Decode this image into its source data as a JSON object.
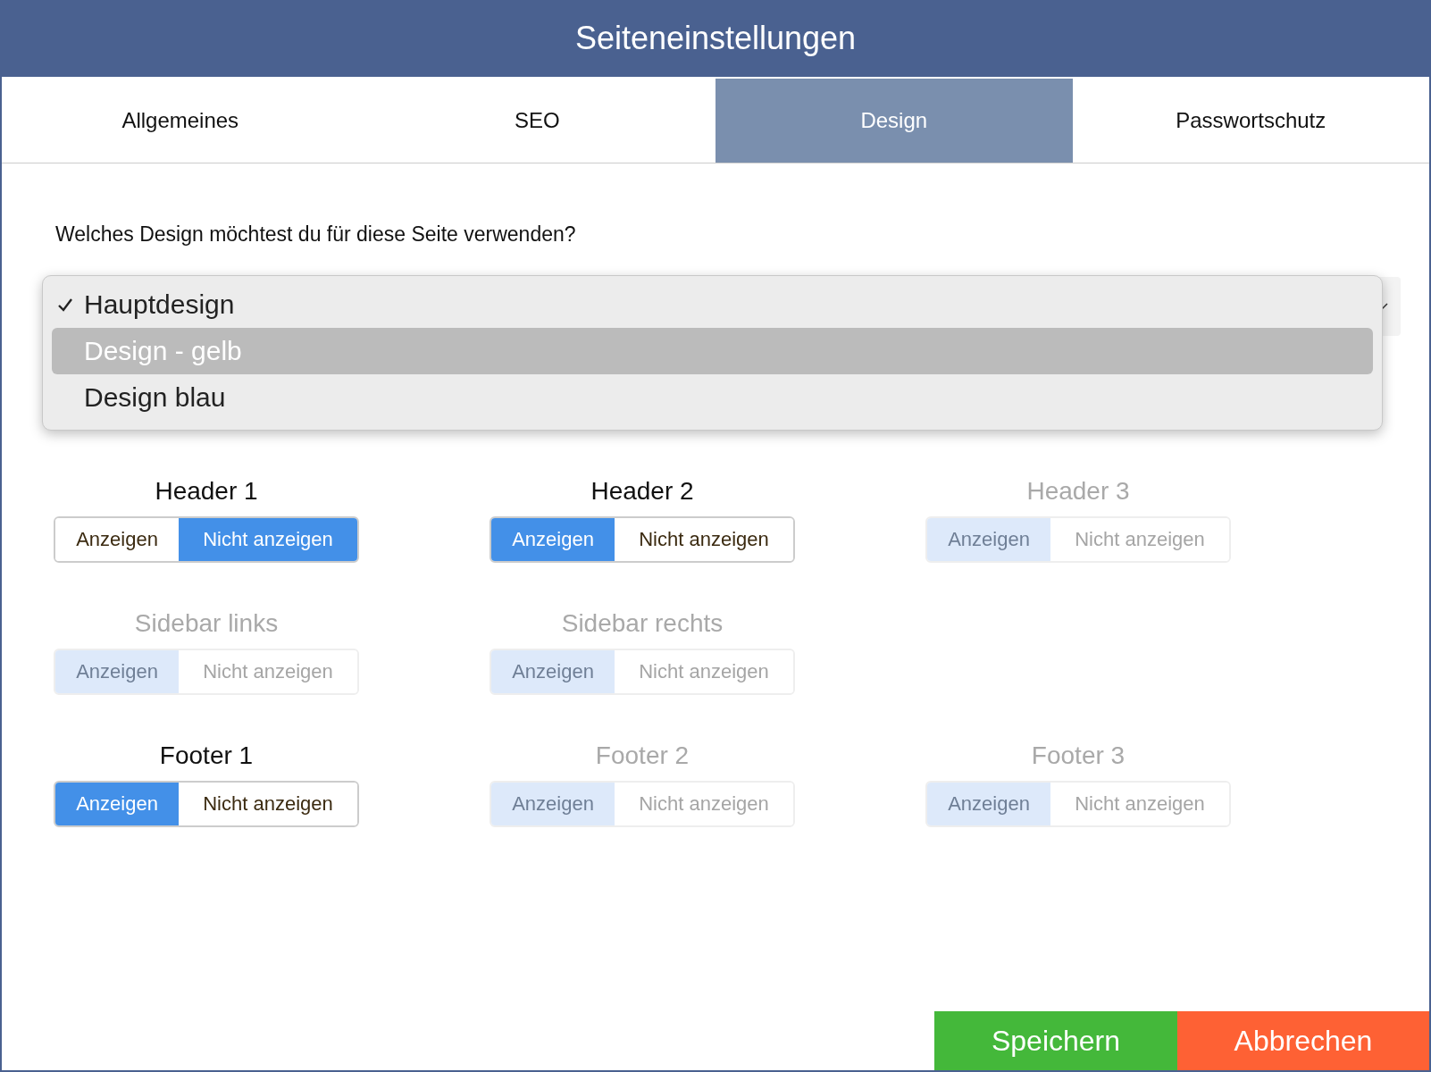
{
  "window": {
    "title": "Seiteneinstellungen"
  },
  "tabs": [
    {
      "label": "Allgemeines",
      "selected": false
    },
    {
      "label": "SEO",
      "selected": false
    },
    {
      "label": "Design",
      "selected": true
    },
    {
      "label": "Passwortschutz",
      "selected": false
    }
  ],
  "question": "Welches Design möchtest du für diese Seite verwenden?",
  "design_menu": {
    "options": [
      {
        "label": "Hauptdesign",
        "checked": true,
        "selected": false
      },
      {
        "label": "Design - gelb",
        "checked": false,
        "selected": true
      },
      {
        "label": "Design blau",
        "checked": false,
        "selected": false
      }
    ]
  },
  "sections": [
    [
      {
        "label": "Header 1",
        "disabled": false,
        "options": [
          {
            "label": "Anzeigen",
            "selected": false
          },
          {
            "label": "Nicht anzeigen",
            "selected": true
          }
        ]
      },
      {
        "label": "Header 2",
        "disabled": false,
        "options": [
          {
            "label": "Anzeigen",
            "selected": true
          },
          {
            "label": "Nicht anzeigen",
            "selected": false
          }
        ]
      },
      {
        "label": "Header 3",
        "disabled": true,
        "options": [
          {
            "label": "Anzeigen",
            "selected": true
          },
          {
            "label": "Nicht anzeigen",
            "selected": false
          }
        ]
      }
    ],
    [
      {
        "label": "Sidebar links",
        "disabled": true,
        "options": [
          {
            "label": "Anzeigen",
            "selected": true
          },
          {
            "label": "Nicht anzeigen",
            "selected": false
          }
        ]
      },
      {
        "label": "Sidebar rechts",
        "disabled": true,
        "options": [
          {
            "label": "Anzeigen",
            "selected": true
          },
          {
            "label": "Nicht anzeigen",
            "selected": false
          }
        ]
      }
    ],
    [
      {
        "label": "Footer 1",
        "disabled": false,
        "options": [
          {
            "label": "Anzeigen",
            "selected": true
          },
          {
            "label": "Nicht anzeigen",
            "selected": false
          }
        ]
      },
      {
        "label": "Footer 2",
        "disabled": true,
        "options": [
          {
            "label": "Anzeigen",
            "selected": true
          },
          {
            "label": "Nicht anzeigen",
            "selected": false
          }
        ]
      },
      {
        "label": "Footer 3",
        "disabled": true,
        "options": [
          {
            "label": "Anzeigen",
            "selected": true
          },
          {
            "label": "Nicht anzeigen",
            "selected": false
          }
        ]
      }
    ]
  ],
  "buttons": [
    {
      "label": "Speichern",
      "kind": "save"
    },
    {
      "label": "Abbrechen",
      "kind": "cancel"
    }
  ]
}
